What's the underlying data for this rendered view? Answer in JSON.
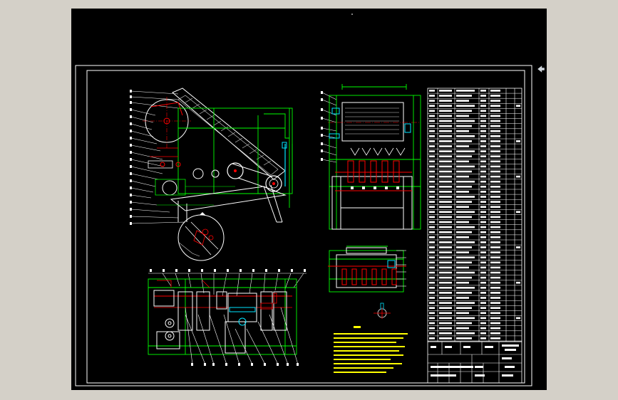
{
  "viewport": {
    "background": "#000000",
    "colors": {
      "frame": "#ffffff",
      "outline": "#00ff00",
      "centerline": "#ff0000",
      "detail": "#00e5ff",
      "hatch": "#d0d0d0",
      "accent": "#ffff00"
    }
  },
  "icons": {
    "cursor": "arrow-left-icon",
    "view_indicator": "dot-icon"
  }
}
